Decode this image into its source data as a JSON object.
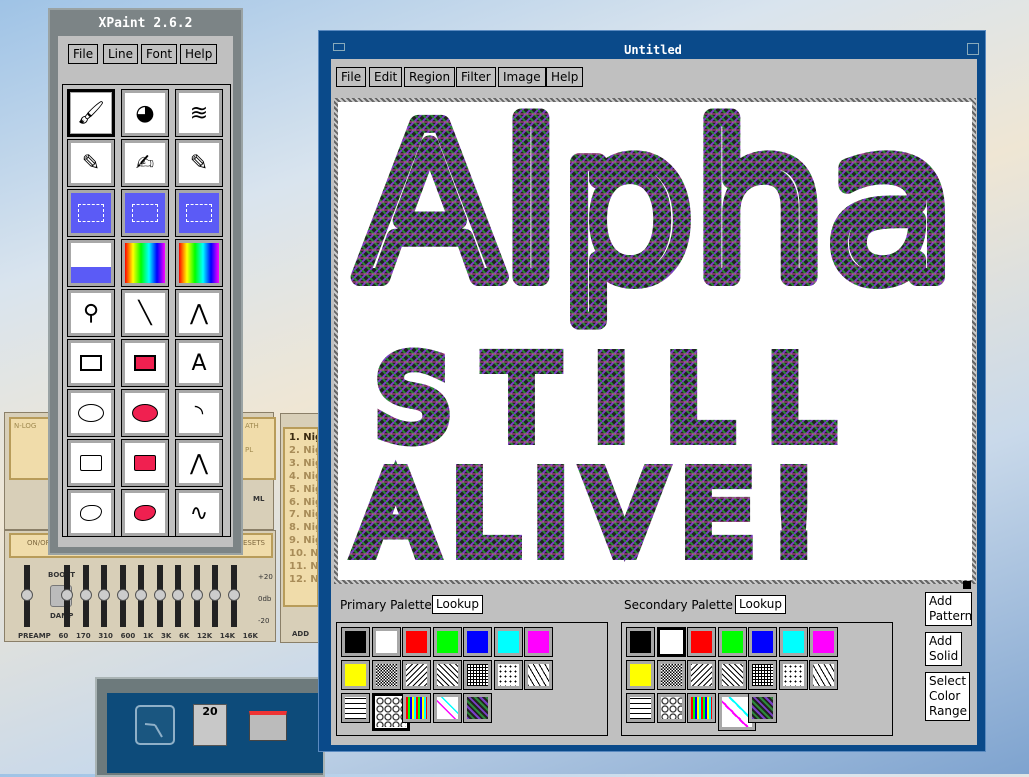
{
  "toolbox": {
    "title": "XPaint 2.6.2",
    "menu": [
      "File",
      "Line",
      "Font",
      "Help"
    ],
    "tools": [
      "brush-icon",
      "paint-fill-icon",
      "spray-icon",
      "pencil-icon",
      "pen-loop-icon",
      "dotted-pencil-icon",
      "select-box-icon",
      "select-lasso-icon",
      "select-dotted-icon",
      "fill-bucket-icon",
      "gradient-fill-icon",
      "rainbow-fill-icon",
      "dropper-icon",
      "line-icon",
      "arc-lines-icon",
      "rectangle-icon",
      "filled-rectangle-icon",
      "text-icon",
      "oval-icon",
      "filled-oval-icon",
      "arc-icon",
      "polygon-icon",
      "filled-polygon-icon",
      "polyline-icon",
      "freehand-shape-icon",
      "filled-freehand-icon",
      "bezier-icon"
    ],
    "selected_tool": 0
  },
  "canvas_window": {
    "title": "Untitled",
    "menu": [
      "File",
      "Edit",
      "Region",
      "Filter",
      "Image",
      "Help"
    ],
    "drawing_text": [
      "Alpha",
      "STILL",
      "ALIVE!"
    ]
  },
  "palettes": {
    "primary": {
      "label": "Primary Palette",
      "lookup": "Lookup",
      "selected": 15
    },
    "secondary": {
      "label": "Secondary Palette",
      "lookup": "Lookup",
      "selected": 1
    },
    "colors": [
      "#000000",
      "#ffffff",
      "#ff0000",
      "#00ff00",
      "#0000ff",
      "#00ffff",
      "#ff00ff",
      "#ffff00"
    ],
    "patterns": [
      "checker",
      "diag-right",
      "diag-left",
      "grid",
      "dots",
      "zigzag",
      "bricks",
      "circles",
      "multicolor",
      "confetti",
      "weave"
    ]
  },
  "side_buttons": [
    "Add Pattern",
    "Add Solid",
    "Select Color Range"
  ],
  "winamp": {
    "playlist": [
      "1. Nig",
      "2. Nig",
      "3. Nig",
      "4. Nig",
      "5. Nig",
      "6. Nig",
      "7. Nig",
      "8. Nig",
      "9. Nig",
      "10. Ni",
      "11. Ni",
      "12. Ni"
    ],
    "eq_labels": [
      "PREAMP",
      "60",
      "170",
      "310",
      "600",
      "1K",
      "3K",
      "6K",
      "12K",
      "14K",
      "16K"
    ],
    "eq_scale": [
      "+20",
      "0db",
      "-20"
    ],
    "boost": "BOOST",
    "damp": "DAMP",
    "presets": "RESETS",
    "on": "ON",
    "off": "OFF",
    "add": "ADD",
    "vis_label": "N-LOG",
    "path": "ATH",
    "pl": "PL",
    "ml": "ML"
  },
  "dock": {
    "calendar_day": "20"
  }
}
